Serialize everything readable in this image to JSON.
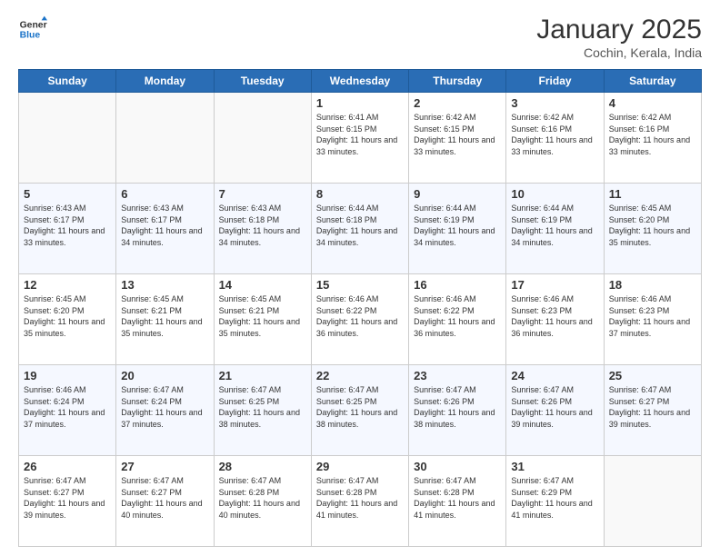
{
  "logo": {
    "line1": "General",
    "line2": "Blue"
  },
  "header": {
    "month": "January 2025",
    "location": "Cochin, Kerala, India"
  },
  "weekdays": [
    "Sunday",
    "Monday",
    "Tuesday",
    "Wednesday",
    "Thursday",
    "Friday",
    "Saturday"
  ],
  "weeks": [
    [
      {
        "day": "",
        "info": ""
      },
      {
        "day": "",
        "info": ""
      },
      {
        "day": "",
        "info": ""
      },
      {
        "day": "1",
        "info": "Sunrise: 6:41 AM\nSunset: 6:15 PM\nDaylight: 11 hours\nand 33 minutes."
      },
      {
        "day": "2",
        "info": "Sunrise: 6:42 AM\nSunset: 6:15 PM\nDaylight: 11 hours\nand 33 minutes."
      },
      {
        "day": "3",
        "info": "Sunrise: 6:42 AM\nSunset: 6:16 PM\nDaylight: 11 hours\nand 33 minutes."
      },
      {
        "day": "4",
        "info": "Sunrise: 6:42 AM\nSunset: 6:16 PM\nDaylight: 11 hours\nand 33 minutes."
      }
    ],
    [
      {
        "day": "5",
        "info": "Sunrise: 6:43 AM\nSunset: 6:17 PM\nDaylight: 11 hours\nand 33 minutes."
      },
      {
        "day": "6",
        "info": "Sunrise: 6:43 AM\nSunset: 6:17 PM\nDaylight: 11 hours\nand 34 minutes."
      },
      {
        "day": "7",
        "info": "Sunrise: 6:43 AM\nSunset: 6:18 PM\nDaylight: 11 hours\nand 34 minutes."
      },
      {
        "day": "8",
        "info": "Sunrise: 6:44 AM\nSunset: 6:18 PM\nDaylight: 11 hours\nand 34 minutes."
      },
      {
        "day": "9",
        "info": "Sunrise: 6:44 AM\nSunset: 6:19 PM\nDaylight: 11 hours\nand 34 minutes."
      },
      {
        "day": "10",
        "info": "Sunrise: 6:44 AM\nSunset: 6:19 PM\nDaylight: 11 hours\nand 34 minutes."
      },
      {
        "day": "11",
        "info": "Sunrise: 6:45 AM\nSunset: 6:20 PM\nDaylight: 11 hours\nand 35 minutes."
      }
    ],
    [
      {
        "day": "12",
        "info": "Sunrise: 6:45 AM\nSunset: 6:20 PM\nDaylight: 11 hours\nand 35 minutes."
      },
      {
        "day": "13",
        "info": "Sunrise: 6:45 AM\nSunset: 6:21 PM\nDaylight: 11 hours\nand 35 minutes."
      },
      {
        "day": "14",
        "info": "Sunrise: 6:45 AM\nSunset: 6:21 PM\nDaylight: 11 hours\nand 35 minutes."
      },
      {
        "day": "15",
        "info": "Sunrise: 6:46 AM\nSunset: 6:22 PM\nDaylight: 11 hours\nand 36 minutes."
      },
      {
        "day": "16",
        "info": "Sunrise: 6:46 AM\nSunset: 6:22 PM\nDaylight: 11 hours\nand 36 minutes."
      },
      {
        "day": "17",
        "info": "Sunrise: 6:46 AM\nSunset: 6:23 PM\nDaylight: 11 hours\nand 36 minutes."
      },
      {
        "day": "18",
        "info": "Sunrise: 6:46 AM\nSunset: 6:23 PM\nDaylight: 11 hours\nand 37 minutes."
      }
    ],
    [
      {
        "day": "19",
        "info": "Sunrise: 6:46 AM\nSunset: 6:24 PM\nDaylight: 11 hours\nand 37 minutes."
      },
      {
        "day": "20",
        "info": "Sunrise: 6:47 AM\nSunset: 6:24 PM\nDaylight: 11 hours\nand 37 minutes."
      },
      {
        "day": "21",
        "info": "Sunrise: 6:47 AM\nSunset: 6:25 PM\nDaylight: 11 hours\nand 38 minutes."
      },
      {
        "day": "22",
        "info": "Sunrise: 6:47 AM\nSunset: 6:25 PM\nDaylight: 11 hours\nand 38 minutes."
      },
      {
        "day": "23",
        "info": "Sunrise: 6:47 AM\nSunset: 6:26 PM\nDaylight: 11 hours\nand 38 minutes."
      },
      {
        "day": "24",
        "info": "Sunrise: 6:47 AM\nSunset: 6:26 PM\nDaylight: 11 hours\nand 39 minutes."
      },
      {
        "day": "25",
        "info": "Sunrise: 6:47 AM\nSunset: 6:27 PM\nDaylight: 11 hours\nand 39 minutes."
      }
    ],
    [
      {
        "day": "26",
        "info": "Sunrise: 6:47 AM\nSunset: 6:27 PM\nDaylight: 11 hours\nand 39 minutes."
      },
      {
        "day": "27",
        "info": "Sunrise: 6:47 AM\nSunset: 6:27 PM\nDaylight: 11 hours\nand 40 minutes."
      },
      {
        "day": "28",
        "info": "Sunrise: 6:47 AM\nSunset: 6:28 PM\nDaylight: 11 hours\nand 40 minutes."
      },
      {
        "day": "29",
        "info": "Sunrise: 6:47 AM\nSunset: 6:28 PM\nDaylight: 11 hours\nand 41 minutes."
      },
      {
        "day": "30",
        "info": "Sunrise: 6:47 AM\nSunset: 6:28 PM\nDaylight: 11 hours\nand 41 minutes."
      },
      {
        "day": "31",
        "info": "Sunrise: 6:47 AM\nSunset: 6:29 PM\nDaylight: 11 hours\nand 41 minutes."
      },
      {
        "day": "",
        "info": ""
      }
    ]
  ]
}
